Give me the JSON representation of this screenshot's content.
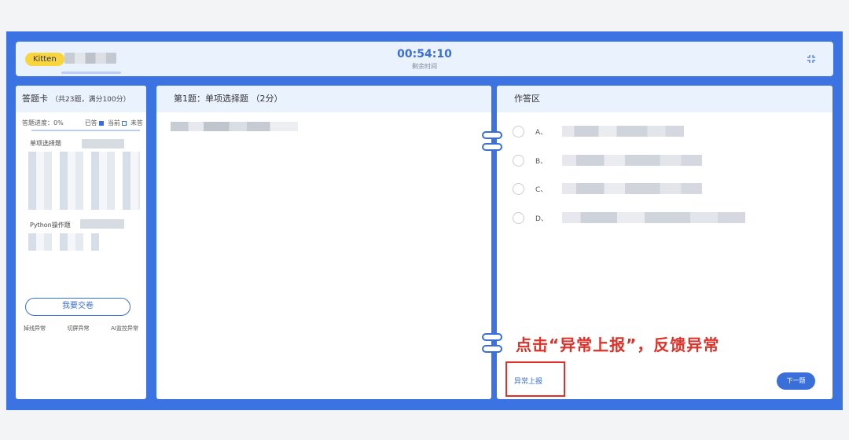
{
  "header": {
    "user_badge": "Kitten",
    "timer": "00:54:10",
    "timer_label": "剩余时间"
  },
  "answer_card": {
    "title": "答题卡",
    "subtitle": "（共23题，满分100分）",
    "progress_label": "答题进度：0%",
    "legend_answered": "已答",
    "legend_current": "当前",
    "legend_unanswered": "未答",
    "sections": [
      {
        "title": "单项选择题"
      },
      {
        "title": "Python操作题"
      }
    ],
    "submit_label": "我要交卷",
    "alerts": [
      "掉线异常",
      "切屏异常",
      "AI监控异常"
    ]
  },
  "question": {
    "header": "第1题：单项选择题 （2分）"
  },
  "answer_area": {
    "header": "作答区",
    "options": [
      {
        "label": "A、"
      },
      {
        "label": "B、"
      },
      {
        "label": "C、"
      },
      {
        "label": "D、"
      }
    ],
    "report_label": "异常上报",
    "next_label": "下一题"
  },
  "annotation": {
    "text": "点击“异常上报”，反馈异常"
  },
  "colors": {
    "frame": "#3b74e2",
    "accent": "#3a6fd9",
    "badge": "#f8d43d",
    "annotation": "#e03028",
    "panel_header": "#eaf2fe"
  }
}
